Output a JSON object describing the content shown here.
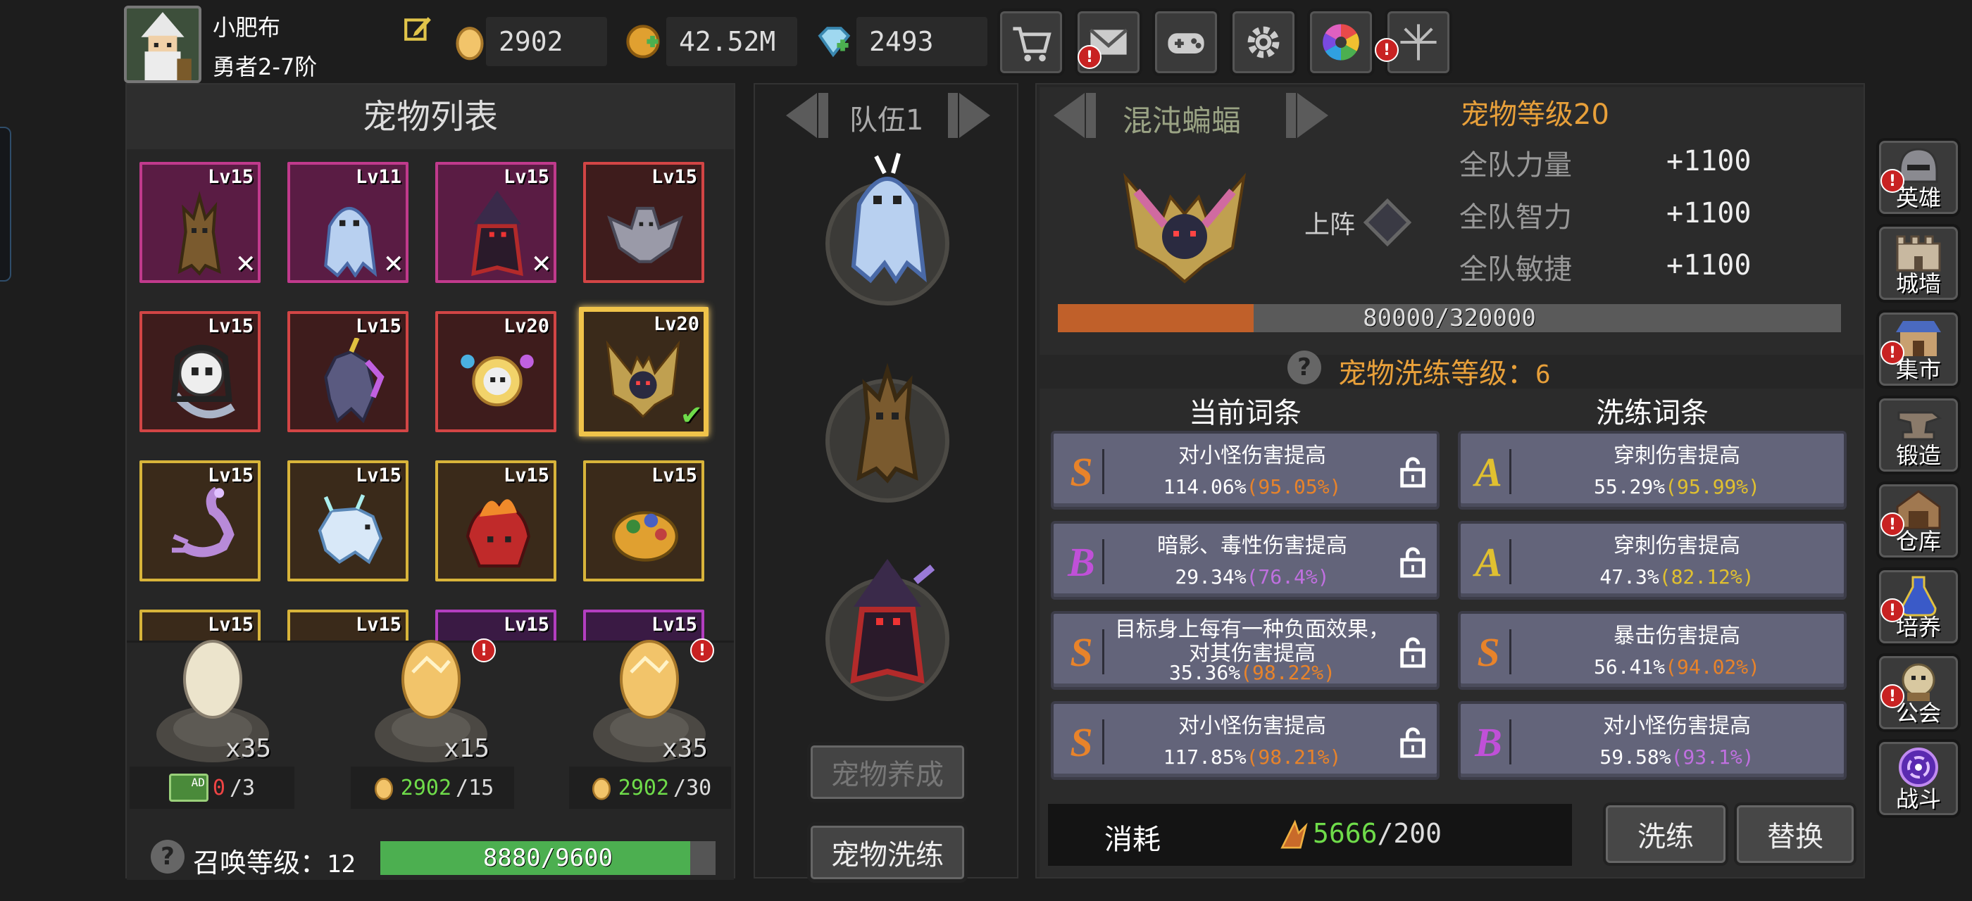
{
  "player": {
    "name": "小肥布",
    "rank": "勇者2-7阶"
  },
  "resources": [
    {
      "icon": "egg-coin-icon",
      "value": "2902"
    },
    {
      "icon": "gold-coin-icon",
      "value": "42.52M"
    },
    {
      "icon": "diamond-icon",
      "value": "2493"
    }
  ],
  "toolbar": [
    {
      "name": "shop-button",
      "icon": "cart-icon",
      "alert": false
    },
    {
      "name": "mail-button",
      "icon": "mail-icon",
      "alert": true,
      "alert_text": "!"
    },
    {
      "name": "gamepad-button",
      "icon": "gamepad-icon",
      "alert": false
    },
    {
      "name": "settings-button",
      "icon": "gear-icon",
      "alert": false
    },
    {
      "name": "color-wheel-button",
      "icon": "color-wheel-icon",
      "alert": false
    },
    {
      "name": "fireworks-button",
      "icon": "fireworks-icon",
      "alert": true,
      "alert_text": "!"
    }
  ],
  "pet_list": {
    "title": "宠物列表",
    "pets": [
      {
        "level": "Lv15",
        "rarity": "magenta",
        "creature": "treant",
        "mark": "x"
      },
      {
        "level": "Lv11",
        "rarity": "magenta",
        "creature": "ghost",
        "mark": "x"
      },
      {
        "level": "Lv15",
        "rarity": "magenta",
        "creature": "witch",
        "mark": "x"
      },
      {
        "level": "Lv15",
        "rarity": "red",
        "creature": "bat",
        "mark": ""
      },
      {
        "level": "Lv15",
        "rarity": "red",
        "creature": "reaper",
        "mark": ""
      },
      {
        "level": "Lv15",
        "rarity": "red",
        "creature": "unicorn",
        "mark": ""
      },
      {
        "level": "Lv20",
        "rarity": "red",
        "creature": "skull",
        "mark": ""
      },
      {
        "level": "Lv20",
        "rarity": "gold",
        "creature": "chaos-bat",
        "mark": "check",
        "selected": true
      },
      {
        "level": "Lv15",
        "rarity": "gold",
        "creature": "scorpion",
        "mark": ""
      },
      {
        "level": "Lv15",
        "rarity": "gold",
        "creature": "ice-beast",
        "mark": ""
      },
      {
        "level": "Lv15",
        "rarity": "gold",
        "creature": "fire-beast",
        "mark": ""
      },
      {
        "level": "Lv15",
        "rarity": "gold",
        "creature": "turtle",
        "mark": ""
      },
      {
        "level": "Lv15",
        "rarity": "gold",
        "creature": "hidden",
        "mark": ""
      },
      {
        "level": "Lv15",
        "rarity": "gold",
        "creature": "hidden",
        "mark": ""
      },
      {
        "level": "Lv15",
        "rarity": "purple",
        "creature": "hidden",
        "mark": ""
      },
      {
        "level": "Lv15",
        "rarity": "purple",
        "creature": "hidden",
        "mark": ""
      }
    ]
  },
  "eggs": [
    {
      "count": "x35",
      "color": "#ece4cc",
      "alert": false,
      "cur": "0",
      "max": "/3",
      "icon": "video-ad-icon"
    },
    {
      "count": "x15",
      "color": "#f2c46a",
      "alert": true,
      "alert_text": "!",
      "cur": "2902",
      "max": "/15",
      "icon": "egg-coin-icon"
    },
    {
      "count": "x35",
      "color": "#f2c46a",
      "alert": true,
      "alert_text": "!",
      "cur": "2902",
      "max": "/30",
      "icon": "egg-coin-icon"
    }
  ],
  "ad_label": "AD",
  "summon": {
    "label": "召唤等级：",
    "level": "12",
    "bar_text": "8880/9600",
    "progress": 0.925
  },
  "team": {
    "label": "队伍1",
    "members": [
      "ghost",
      "treant",
      "witch"
    ],
    "btn_raise": "宠物养成",
    "btn_wash": "宠物洗练"
  },
  "detail": {
    "name": "混沌蝙蝠",
    "deploy_label": "上阵",
    "level_label": "宠物等级20",
    "stats": [
      {
        "name": "全队力量",
        "value": "+1100"
      },
      {
        "name": "全队智力",
        "value": "+1100"
      },
      {
        "name": "全队敏捷",
        "value": "+1100"
      }
    ],
    "exp_text": "80000/320000",
    "exp_progress": 0.25,
    "wash_label": "宠物洗练等级：",
    "wash_level": "6",
    "current_head": "当前词条",
    "wash_head": "洗练词条",
    "current": [
      {
        "rank": "S",
        "rank_color": "#e8832a",
        "line1": "对小怪伤害提高",
        "val": "114.06%",
        "pct": "(95.05%)",
        "pct_color": "#e8832a"
      },
      {
        "rank": "B",
        "rank_color": "#c050d8",
        "line1": "暗影、毒性伤害提高",
        "val": "29.34%",
        "pct": "(76.4%)",
        "pct_color": "#c070e0"
      },
      {
        "rank": "S",
        "rank_color": "#e8832a",
        "line1": "目标身上每有一种负面效果，",
        "line1b": "对其伤害提高",
        "val": "35.36%",
        "pct": "(98.22%)",
        "pct_color": "#e8832a"
      },
      {
        "rank": "S",
        "rank_color": "#e8832a",
        "line1": "对小怪伤害提高",
        "val": "117.85%",
        "pct": "(98.21%)",
        "pct_color": "#e8832a"
      }
    ],
    "washed": [
      {
        "rank": "A",
        "rank_color": "#e0c030",
        "line1": "穿刺伤害提高",
        "val": "55.29%",
        "pct": "(95.99%)",
        "pct_color": "#e0c030"
      },
      {
        "rank": "A",
        "rank_color": "#e0c030",
        "line1": "穿刺伤害提高",
        "val": "47.3%",
        "pct": "(82.12%)",
        "pct_color": "#e0c030"
      },
      {
        "rank": "S",
        "rank_color": "#e8832a",
        "line1": "暴击伤害提高",
        "val": "56.41%",
        "pct": "(94.02%)",
        "pct_color": "#e8832a"
      },
      {
        "rank": "B",
        "rank_color": "#c050d8",
        "line1": "对小怪伤害提高",
        "val": "59.58%",
        "pct": "(93.1%)",
        "pct_color": "#c070e0"
      }
    ],
    "cost_label": "消耗",
    "cost_have": "5666",
    "cost_need": "/200",
    "btn_wash": "洗练",
    "btn_replace": "替换"
  },
  "sidebar": [
    {
      "label": "英雄",
      "icon": "helmet-icon",
      "alert": true,
      "alert_text": "!"
    },
    {
      "label": "城墙",
      "icon": "wall-icon",
      "alert": false
    },
    {
      "label": "集市",
      "icon": "market-icon",
      "alert": true,
      "alert_text": "!"
    },
    {
      "label": "锻造",
      "icon": "anvil-icon",
      "alert": false
    },
    {
      "label": "仓库",
      "icon": "warehouse-icon",
      "alert": true,
      "alert_text": "!"
    },
    {
      "label": "培养",
      "icon": "potion-icon",
      "alert": true,
      "alert_text": "!"
    },
    {
      "label": "公会",
      "icon": "guild-icon",
      "alert": true,
      "alert_text": "!"
    },
    {
      "label": "战斗",
      "icon": "portal-icon",
      "alert": false
    }
  ]
}
